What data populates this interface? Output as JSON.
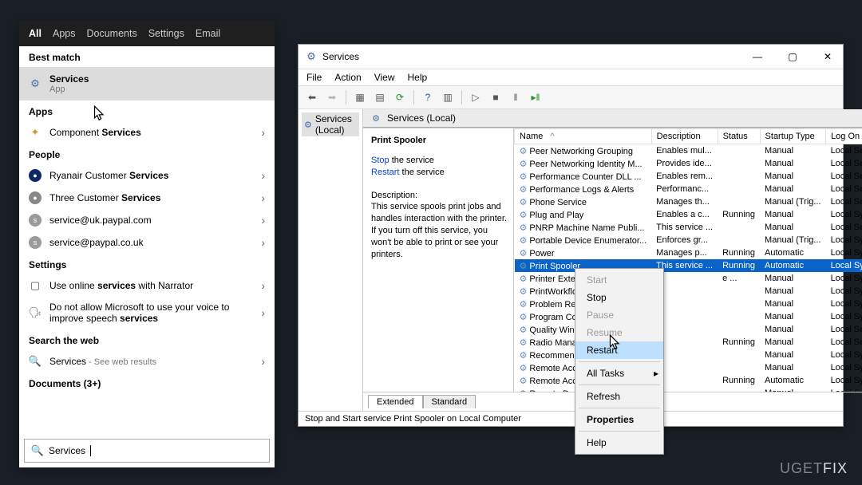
{
  "start": {
    "tabs": [
      "All",
      "Apps",
      "Documents",
      "Settings",
      "Email"
    ],
    "bestMatch": "Best match",
    "top": {
      "title": "Services",
      "sub": "App"
    },
    "appsHdr": "Apps",
    "apps": [
      {
        "label": "Component Services"
      }
    ],
    "peopleHdr": "People",
    "people": [
      {
        "label": "Ryanair Customer Services",
        "bg": "#0a2a66"
      },
      {
        "label": "Three Customer Services",
        "bg": "#888"
      },
      {
        "label": "service@uk.paypal.com",
        "bg": "#9a9a9a",
        "initial": "s"
      },
      {
        "label": "service@paypal.co.uk",
        "bg": "#9a9a9a",
        "initial": "s"
      }
    ],
    "settingsHdr": "Settings",
    "settings": [
      {
        "label": "Use online services with Narrator"
      },
      {
        "label": "Do not allow Microsoft to use your voice to improve speech services"
      }
    ],
    "webHdr": "Search the web",
    "web": {
      "label": "Services",
      "hint": " - See web results"
    },
    "docsHdr": "Documents (3+)",
    "searchValue": "Services"
  },
  "svc": {
    "title": "Services",
    "menus": [
      "File",
      "Action",
      "View",
      "Help"
    ],
    "tree": "Services (Local)",
    "rightHeader": "Services (Local)",
    "detail": {
      "title": "Print Spooler",
      "stop": "Stop",
      "stop_after": " the service",
      "restart": "Restart",
      "restart_after": " the service",
      "descLabel": "Description:",
      "desc": "This service spools print jobs and handles interaction with the printer. If you turn off this service, you won't be able to print or see your printers."
    },
    "cols": [
      "Name",
      "Description",
      "Status",
      "Startup Type",
      "Log On As"
    ],
    "rows": [
      {
        "n": "Peer Networking Grouping",
        "d": "Enables mul...",
        "s": "",
        "t": "Manual",
        "l": "Local Service"
      },
      {
        "n": "Peer Networking Identity M...",
        "d": "Provides ide...",
        "s": "",
        "t": "Manual",
        "l": "Local Service"
      },
      {
        "n": "Performance Counter DLL ...",
        "d": "Enables rem...",
        "s": "",
        "t": "Manual",
        "l": "Local Service"
      },
      {
        "n": "Performance Logs & Alerts",
        "d": "Performanc...",
        "s": "",
        "t": "Manual",
        "l": "Local Service"
      },
      {
        "n": "Phone Service",
        "d": "Manages th...",
        "s": "",
        "t": "Manual (Trig...",
        "l": "Local Service"
      },
      {
        "n": "Plug and Play",
        "d": "Enables a c...",
        "s": "Running",
        "t": "Manual",
        "l": "Local Syste..."
      },
      {
        "n": "PNRP Machine Name Publi...",
        "d": "This service ...",
        "s": "",
        "t": "Manual",
        "l": "Local Service"
      },
      {
        "n": "Portable Device Enumerator...",
        "d": "Enforces gr...",
        "s": "",
        "t": "Manual (Trig...",
        "l": "Local Syste..."
      },
      {
        "n": "Power",
        "d": "Manages p...",
        "s": "Running",
        "t": "Automatic",
        "l": "Local Syste..."
      },
      {
        "n": "Print Spooler",
        "d": "This service ...",
        "s": "Running",
        "t": "Automatic",
        "l": "Local Syste...",
        "sel": true
      },
      {
        "n": "Printer Extens",
        "d": "",
        "s": "e ...",
        "t": "Manual",
        "l": "Local Syste..."
      },
      {
        "n": "PrintWorkflow",
        "d": "",
        "s": "",
        "t": "Manual",
        "l": "Local Syste..."
      },
      {
        "n": "Problem Repo",
        "d": "",
        "s": "",
        "t": "Manual",
        "l": "Local Syste..."
      },
      {
        "n": "Program Con",
        "d": "",
        "s": "",
        "t": "Manual",
        "l": "Local Syste..."
      },
      {
        "n": "Quality Wind",
        "d": "",
        "s": "",
        "t": "Manual",
        "l": "Local Service"
      },
      {
        "n": "Radio Manag",
        "d": "",
        "s": "Running",
        "t": "Manual",
        "l": "Local Service"
      },
      {
        "n": "Recommende",
        "d": "",
        "s": "",
        "t": "Manual",
        "l": "Local Syste..."
      },
      {
        "n": "Remote Acce",
        "d": "",
        "s": "",
        "t": "Manual",
        "l": "Local Syste..."
      },
      {
        "n": "Remote Acce",
        "d": "",
        "s": "Running",
        "t": "Automatic",
        "l": "Local Syste..."
      },
      {
        "n": "Remote Desk",
        "d": "",
        "s": "",
        "t": "Manual",
        "l": "Local Syste..."
      }
    ],
    "btabs": [
      "Extended",
      "Standard"
    ],
    "status": "Stop and Start service Print Spooler on Local Computer"
  },
  "ctx": [
    {
      "l": "Start",
      "dis": true
    },
    {
      "l": "Stop"
    },
    {
      "l": "Pause",
      "dis": true
    },
    {
      "l": "Resume",
      "dis": true
    },
    {
      "l": "Restart",
      "hi": true
    },
    {
      "sep": true
    },
    {
      "l": "All Tasks",
      "sub": true
    },
    {
      "sep": true
    },
    {
      "l": "Refresh"
    },
    {
      "sep": true
    },
    {
      "l": "Properties",
      "bold": true
    },
    {
      "sep": true
    },
    {
      "l": "Help"
    }
  ],
  "watermark": {
    "a": "UGET",
    "b": "FIX"
  }
}
